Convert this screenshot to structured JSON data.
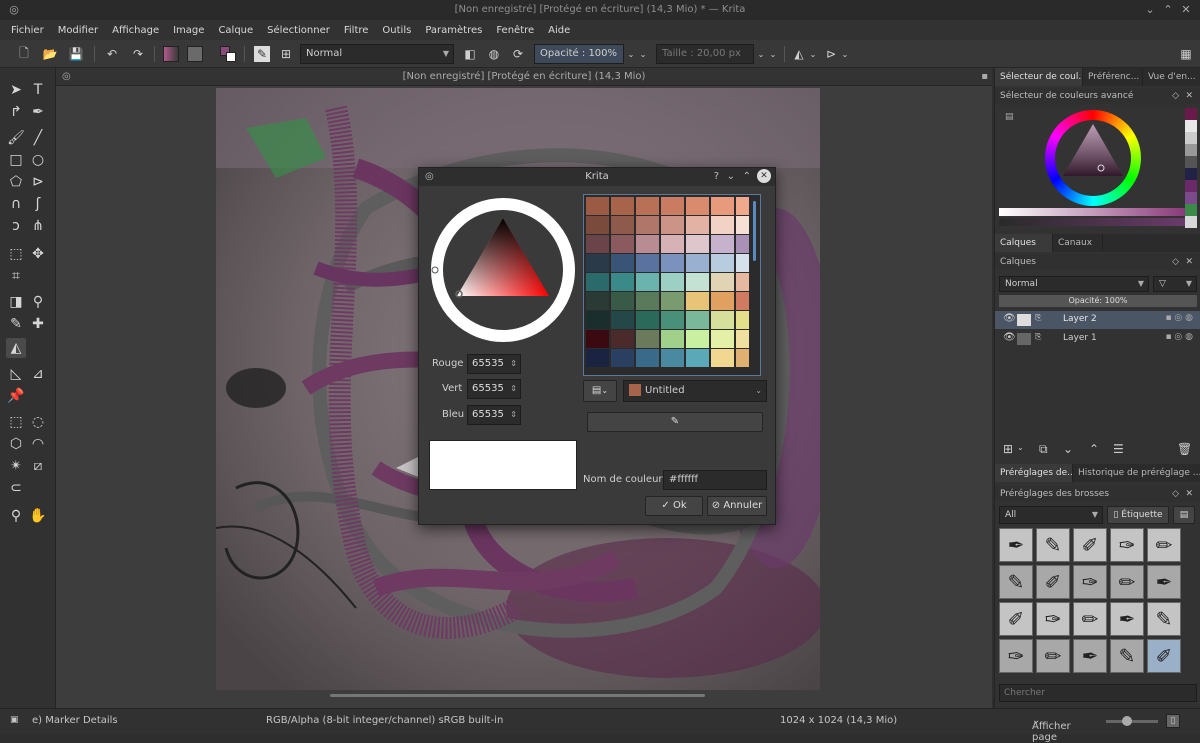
{
  "window": {
    "title": "[Non enregistré] [Protégé en écriture] (14,3 Mio) * — Krita"
  },
  "menu": [
    "Fichier",
    "Modifier",
    "Affichage",
    "Image",
    "Calque",
    "Sélectionner",
    "Filtre",
    "Outils",
    "Paramètres",
    "Fenêtre",
    "Aide"
  ],
  "toolbar": {
    "blend_mode": "Normal",
    "opacity_label": "Opacité :",
    "opacity_value": "100%",
    "size_label": "Taille :",
    "size_value": "20,00 px"
  },
  "document": {
    "tab_title": "[Non enregistré]  [Protégé en écriture]  (14,3 Mio)"
  },
  "dialog": {
    "title": "Krita",
    "rgb": [
      {
        "label": "Rouge",
        "value": "65535"
      },
      {
        "label": "Vert",
        "value": "65535"
      },
      {
        "label": "Bleu",
        "value": "65535"
      }
    ],
    "palette_name": "Untitled",
    "color_name_label": "Nom de couleur :",
    "color_name_value": "#ffffff",
    "ok_label": "Ok",
    "cancel_label": "Annuler",
    "current_color": "#ffffff",
    "swatches": [
      [
        "#9a5a44",
        "#a8644a",
        "#b87056",
        "#c97c62",
        "#da8b6e",
        "#e89a7c",
        "#f0a98c"
      ],
      [
        "#7a4a3c",
        "#8e5a4c",
        "#b0766a",
        "#cc9486",
        "#e2b2a4",
        "#f2d2c4",
        "#f6e0d6"
      ],
      [
        "#6a4448",
        "#8a5a5e",
        "#b88c92",
        "#d6b2b6",
        "#ddc6cc",
        "#c6b2cc",
        "#a890b6"
      ],
      [
        "#2a3a48",
        "#3a5478",
        "#5a72a0",
        "#7c92be",
        "#9ab0d0",
        "#b8cce0",
        "#d4e0ec"
      ],
      [
        "#2a6a6a",
        "#3a8a8a",
        "#6ab4b0",
        "#9cd0c4",
        "#c4e2d4",
        "#e0d4b4",
        "#e6b8a0"
      ],
      [
        "#2a3a34",
        "#3a5a48",
        "#5a7a5c",
        "#7a9a70",
        "#e8c478",
        "#e0a060",
        "#d07a62"
      ],
      [
        "#1a2e2e",
        "#244848",
        "#2a6a5a",
        "#48907a",
        "#7ab89a",
        "#d6e09a",
        "#e4e08a"
      ],
      [
        "#3a0a10",
        "#4a2a2a",
        "#6a7a5a",
        "#a0d08a",
        "#c8f0a0",
        "#e4f0a8",
        "#f0e0a0"
      ],
      [
        "#1a2440",
        "#2a4060",
        "#3a6a8a",
        "#4a8aa0",
        "#5aa8b8",
        "#f0d890",
        "#e0b070"
      ]
    ]
  },
  "dock": {
    "top_tabs": [
      "Sélecteur de coul...",
      "Préférenc...",
      "Vue d'en..."
    ],
    "advanced_selector_title": "Sélecteur de couleurs avancé",
    "layer_tabs": [
      "Calques",
      "Canaux"
    ],
    "layers_title": "Calques",
    "layers_blend": "Normal",
    "layers_opacity": "Opacité:  100%",
    "layers": [
      {
        "name": "Layer 2",
        "selected": true
      },
      {
        "name": "Layer 1",
        "selected": false
      }
    ],
    "preset_tabs": [
      "Préréglages de...",
      "Historique de préréglage ..."
    ],
    "presets_title": "Préréglages des brosses",
    "presets_filter": "All",
    "presets_tag_label": "Étiquette",
    "search_placeholder": "Chercher",
    "side_strip": [
      "#6a1a4a",
      "#e8e8e8",
      "#cccccc",
      "#999999",
      "#555555",
      "#222244",
      "#6a2a6a",
      "#7a4a8a",
      "#3a8a4a",
      "#d8d8d8"
    ]
  },
  "status": {
    "brush": "e) Marker Details",
    "colorspace": "RGB/Alpha (8-bit integer/channel)  sRGB built-in",
    "dimensions": "1024 x 1024 (14,3 Mio)",
    "zoom_label": "Afficher page"
  },
  "icons": {
    "ok": "check-icon",
    "cancel": "cancel-icon",
    "eyedropper": "eyedropper-icon"
  }
}
